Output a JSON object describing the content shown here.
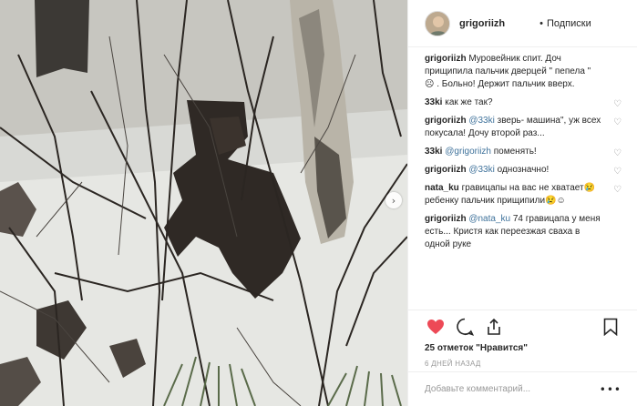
{
  "post": {
    "username": "grigoriizh",
    "follow_dot": "•",
    "follow_label": "Подписки"
  },
  "comments": [
    {
      "user": "grigoriizh",
      "mention": "",
      "text": "Муровейник спит. Доч прищипила пальчик дверцей \" пепела \" ☹ . Больно! Держит пальчик вверх."
    },
    {
      "user": "33ki",
      "mention": "",
      "text": "как же так?"
    },
    {
      "user": "grigoriizh",
      "mention": "@33ki",
      "text": "зверь- машина\", уж всех покусала! Дочу второй раз..."
    },
    {
      "user": "33ki",
      "mention": "@grigoriizh",
      "text": "поменять!"
    },
    {
      "user": "grigoriizh",
      "mention": "@33ki",
      "text": "однозначно!"
    },
    {
      "user": "nata_ku",
      "mention": "",
      "text": "гравицапы на вас не хватает😢ребенку пальчик прищипили😢☺"
    },
    {
      "user": "grigoriizh",
      "mention": "@nata_ku",
      "text": "74 гравицапа у меня есть... Кристя как переезжая сваха в одной руке"
    }
  ],
  "actions": {
    "likes_text": "25 отметок \"Нравится\"",
    "date_text": "6 ДНЕЙ НАЗАД"
  },
  "add_comment": {
    "placeholder": "Добавьте комментарий...",
    "more": "•••"
  },
  "photo": {
    "next_arrow": "›"
  },
  "colors": {
    "like_red": "#ed4956",
    "mention_blue": "#3f729b",
    "border": "#efefef",
    "snow": "#e9eae6",
    "soil": "#2e2824"
  }
}
